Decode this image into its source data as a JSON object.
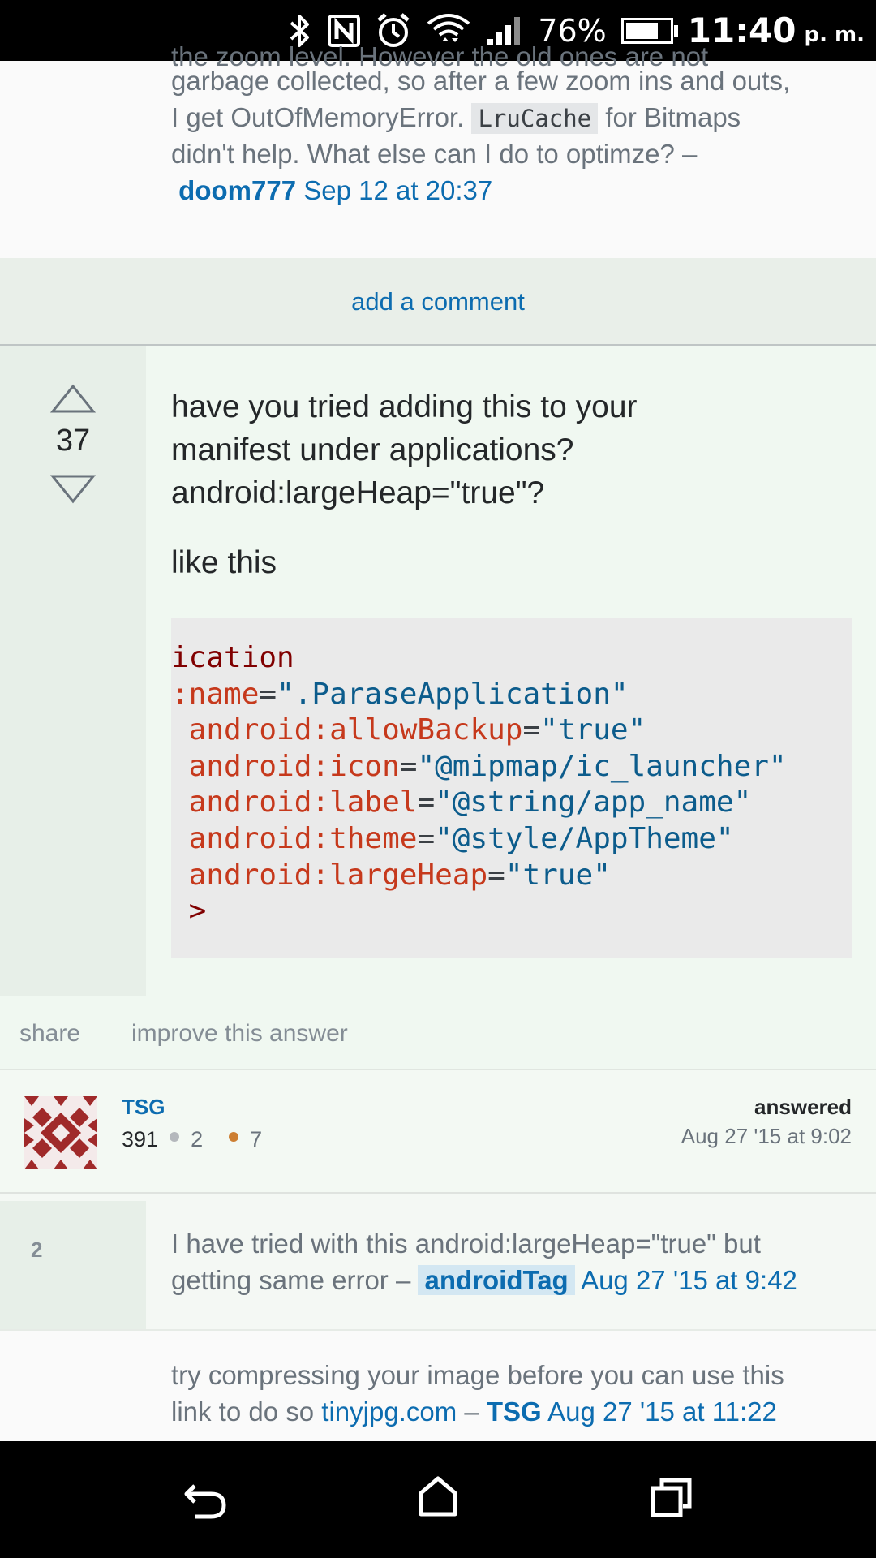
{
  "status_bar": {
    "battery_percent": "76%",
    "battery_level": 0.76,
    "time": "11:40",
    "ampm": "p. m.",
    "icons": [
      "bluetooth-icon",
      "nfc-icon",
      "alarm-icon",
      "wifi-icon",
      "signal-icon",
      "battery-icon"
    ]
  },
  "top_comment": {
    "line0": "the zoom level. However the old ones are not",
    "line1": "garbage collected, so after a few zoom ins and outs,",
    "line2_pre": "I get OutOfMemoryError.",
    "line2_code": "LruCache",
    "line2_post": "for Bitmaps",
    "line3": "didn't help. What else can I do to optimze? –",
    "user": "doom777",
    "date": "Sep 12 at 20:37"
  },
  "add_comment_label": "add a comment",
  "answer": {
    "votes": "37",
    "para1_line1": "have you tried adding this to your",
    "para1_line2": "manifest under applications?",
    "para1_line3": "android:largeHeap=\"true\"?",
    "para2": "like this",
    "code": [
      {
        "tag": "ication"
      },
      {
        "attr": ":name",
        "val": "\".ParaseApplication\""
      },
      {
        "attr": " android:allowBackup",
        "val": "\"true\""
      },
      {
        "attr": " android:icon",
        "val": "\"@mipmap/ic_launcher\""
      },
      {
        "attr": " android:label",
        "val": "\"@string/app_name\""
      },
      {
        "attr": " android:theme",
        "val": "\"@style/AppTheme\""
      },
      {
        "attr": " android:largeHeap",
        "val": "\"true\""
      },
      {
        "tag": " >"
      }
    ]
  },
  "actions": {
    "share": "share",
    "improve": "improve this answer"
  },
  "user_card": {
    "name": "TSG",
    "reputation": "391",
    "silver": "2",
    "bronze": "7",
    "answered_label": "answered",
    "answered_date": "Aug 27 '15 at 9:02"
  },
  "comments": [
    {
      "score": "2",
      "line1": "I have tried with this android:largeHeap=\"true\" but",
      "line2": "getting same error –",
      "user": "androidTag",
      "date": "Aug 27 '15 at 9:42"
    },
    {
      "line1": "try compressing your image before you can use this",
      "line2_pre": "link to do so",
      "link": "tinyjpg.com",
      "dash": "–",
      "user": "TSG",
      "date": "Aug 27 '15 at 11:22"
    }
  ],
  "colors": {
    "link": "#0c6cb0",
    "answer_bg": "#f0f8f1",
    "vote_bg": "#e7efe8",
    "code_bg": "#eaeaea"
  }
}
